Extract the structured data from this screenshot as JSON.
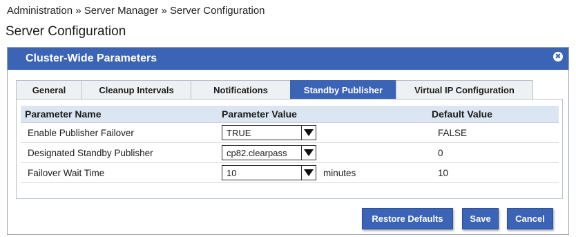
{
  "breadcrumb": "Administration » Server Manager » Server Configuration",
  "page_title": "Server Configuration",
  "panel": {
    "title": "Cluster-Wide Parameters",
    "close_glyph": "✖"
  },
  "tabs": [
    {
      "label": "General",
      "active": false
    },
    {
      "label": "Cleanup Intervals",
      "active": false
    },
    {
      "label": "Notifications",
      "active": false
    },
    {
      "label": "Standby Publisher",
      "active": true
    },
    {
      "label": "Virtual IP  Configuration",
      "active": false
    }
  ],
  "table": {
    "headers": {
      "name": "Parameter Name",
      "value": "Parameter Value",
      "default": "Default Value"
    },
    "rows": [
      {
        "name": "Enable Publisher Failover",
        "value": "TRUE",
        "unit": "",
        "default": "FALSE"
      },
      {
        "name": "Designated Standby Publisher",
        "value": "cp82.clearpass",
        "unit": "",
        "default": "0"
      },
      {
        "name": "Failover Wait Time",
        "value": "10",
        "unit": "minutes",
        "default": "10"
      }
    ]
  },
  "buttons": {
    "restore": "Restore Defaults",
    "save": "Save",
    "cancel": "Cancel"
  },
  "colors": {
    "accent": "#3b63b6",
    "header_row": "#dce6f2",
    "tab_inactive": "#eef1f4"
  }
}
